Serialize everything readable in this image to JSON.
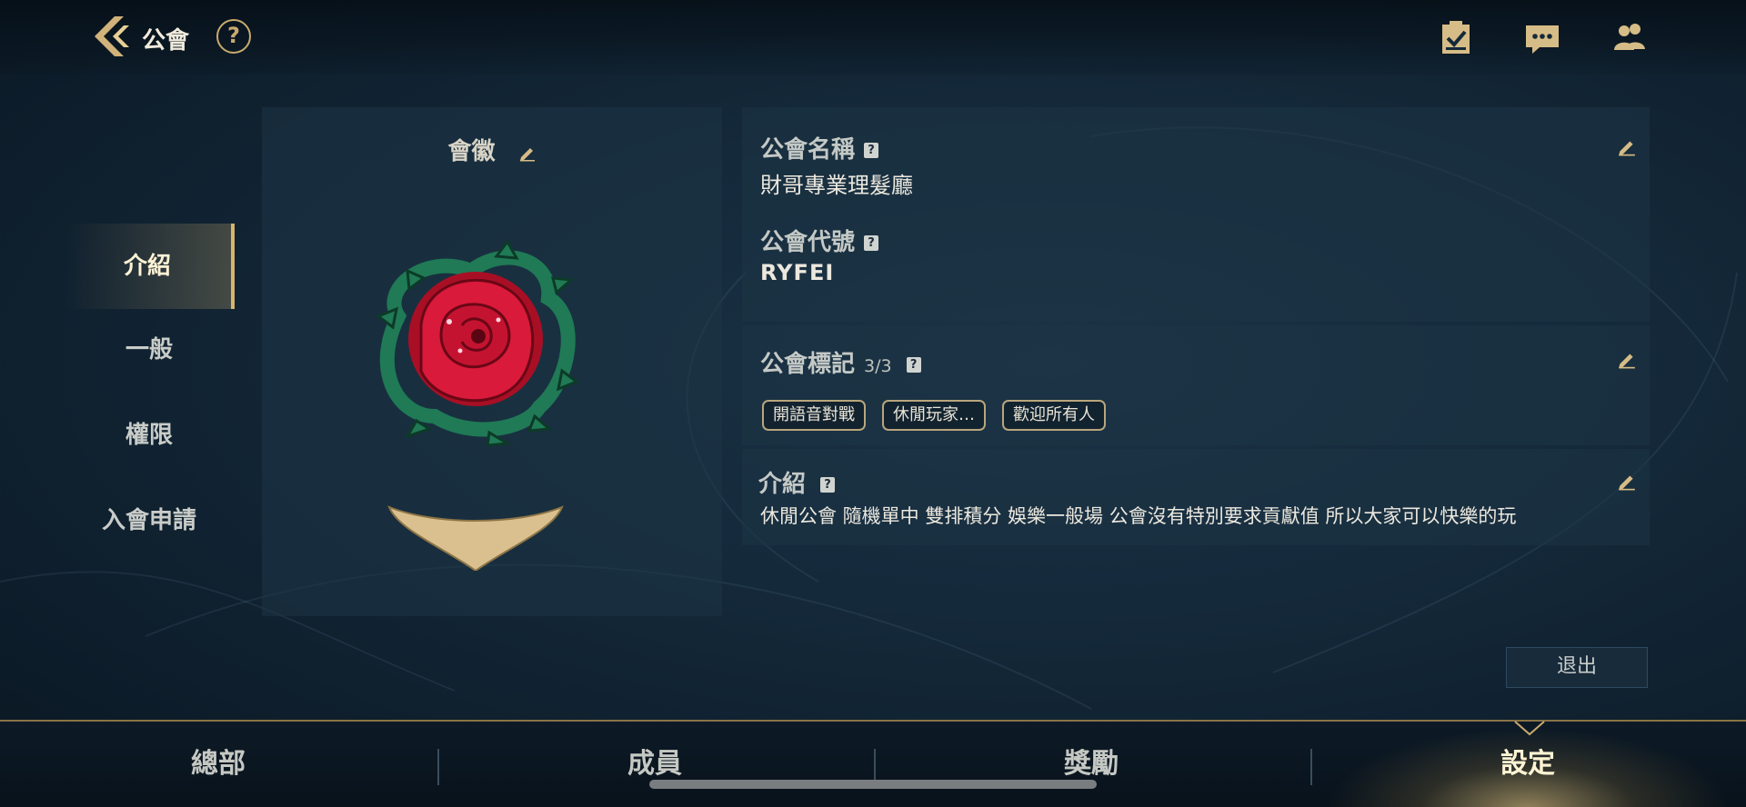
{
  "header": {
    "title": "公會",
    "help_label": "?",
    "icons": [
      "back-icon",
      "help-icon",
      "checklist-icon",
      "chat-icon",
      "friends-icon"
    ]
  },
  "sidebar": {
    "items": [
      {
        "label": "介紹",
        "active": true
      },
      {
        "label": "一般",
        "active": false
      },
      {
        "label": "權限",
        "active": false
      },
      {
        "label": "入會申請",
        "active": false
      }
    ]
  },
  "emblem": {
    "title": "會徽"
  },
  "guild": {
    "name_label": "公會名稱",
    "name_value": "財哥專業理髮廳",
    "code_label": "公會代號",
    "code_value": "RYFEI",
    "tags_label": "公會標記",
    "tags_count": "3/3",
    "tags": [
      "開語音對戰",
      "休閒玩家…",
      "歡迎所有人"
    ],
    "intro_label": "介紹",
    "intro_value": "休閒公會 隨機單中 雙排積分 娛樂一般場 公會沒有特別要求貢獻值 所以大家可以快樂的玩"
  },
  "actions": {
    "exit_label": "退出"
  },
  "bottom_tabs": [
    {
      "label": "總部",
      "active": false
    },
    {
      "label": "成員",
      "active": false
    },
    {
      "label": "獎勵",
      "active": false
    },
    {
      "label": "設定",
      "active": true
    }
  ],
  "colors": {
    "accent_gold": "#c8aa6e",
    "background": "#14293a",
    "panel": "#1e3446"
  }
}
